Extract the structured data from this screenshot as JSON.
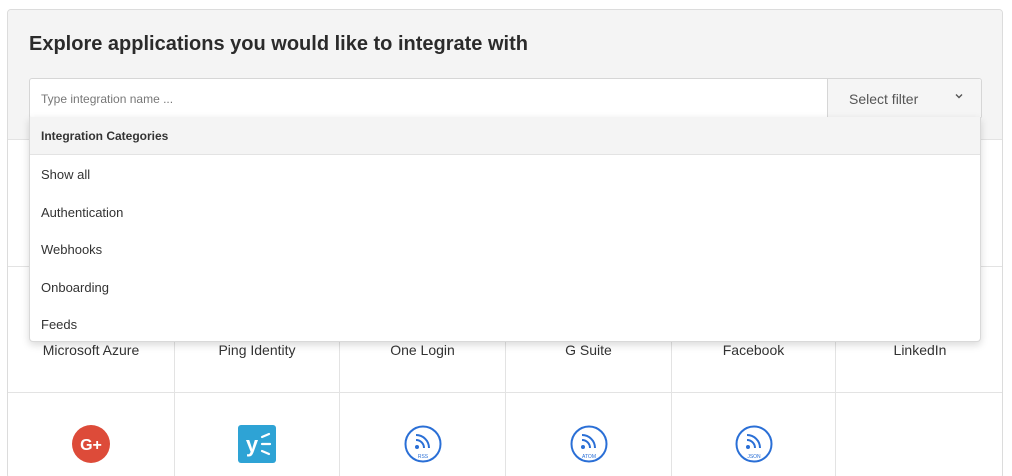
{
  "header": {
    "title": "Explore applications you would like to integrate with"
  },
  "search": {
    "placeholder": "Type integration name ...",
    "value": ""
  },
  "filter": {
    "label": "Select filter"
  },
  "dropdown": {
    "header": "Integration Categories",
    "items": [
      "Show all",
      "Authentication",
      "Webhooks",
      "Onboarding",
      "Feeds"
    ]
  },
  "tiles_row2": [
    "Microsoft Azure",
    "Ping Identity",
    "One Login",
    "G Suite",
    "Facebook",
    "LinkedIn"
  ],
  "tiles_row3": [
    {
      "icon": "google-plus-icon",
      "color": "#dd4b39",
      "text": "G+"
    },
    {
      "icon": "yammer-icon",
      "color": "#2ea3d5",
      "text": "y"
    },
    {
      "icon": "rss-feed-icon",
      "color": "#2a6fd6",
      "text": "RSS"
    },
    {
      "icon": "atom-feed-icon",
      "color": "#2a6fd6",
      "text": "ATOM"
    },
    {
      "icon": "json-feed-icon",
      "color": "#2a6fd6",
      "text": "JSON"
    }
  ]
}
